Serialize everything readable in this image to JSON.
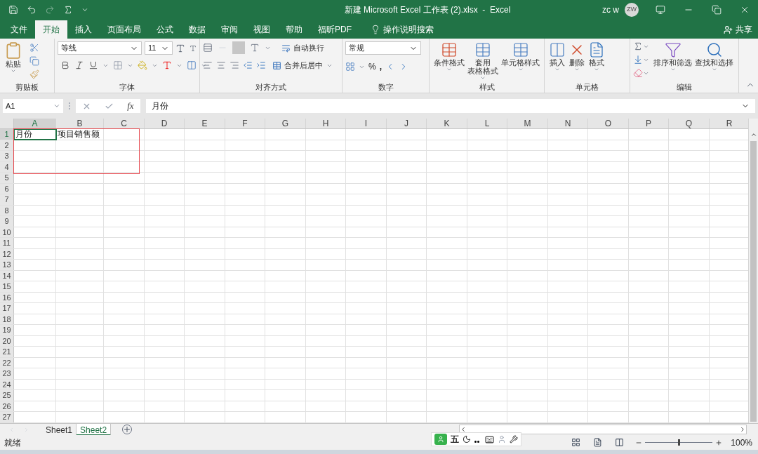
{
  "title_bar": {
    "title": "新建 Microsoft Excel 工作表 (2).xlsx  -  Excel",
    "user_name": "zc w",
    "user_initials": "ZW"
  },
  "ribbon_tabs": [
    {
      "label": "文件",
      "selected": false
    },
    {
      "label": "开始",
      "selected": true
    },
    {
      "label": "插入",
      "selected": false
    },
    {
      "label": "页面布局",
      "selected": false
    },
    {
      "label": "公式",
      "selected": false
    },
    {
      "label": "数据",
      "selected": false
    },
    {
      "label": "审阅",
      "selected": false
    },
    {
      "label": "视图",
      "selected": false
    },
    {
      "label": "帮助",
      "selected": false
    },
    {
      "label": "福昕PDF",
      "selected": false
    }
  ],
  "tell_me": "操作说明搜索",
  "share": "共享",
  "ribbon": {
    "clipboard": {
      "paste": "粘贴",
      "label": "剪贴板"
    },
    "font": {
      "font_name": "等线",
      "font_size": "11",
      "label": "字体"
    },
    "alignment": {
      "wrap": "自动换行",
      "merge": "合并后居中",
      "label": "对齐方式"
    },
    "number": {
      "format": "常规",
      "percent": "%",
      "comma": ",",
      "label": "数字"
    },
    "styles": {
      "buttons": [
        {
          "lines": [
            "条件格式"
          ]
        },
        {
          "lines": [
            "套用",
            "表格格式"
          ]
        },
        {
          "lines": [
            "单元格样式"
          ]
        }
      ],
      "label": "样式"
    },
    "cells": {
      "buttons": [
        "插入",
        "删除",
        "格式"
      ],
      "label": "单元格"
    },
    "editing": {
      "sort": "排序和筛选",
      "find": "查找和选择",
      "label": "编辑"
    }
  },
  "formula_bar": {
    "name_box": "A1",
    "fx": "fx",
    "content": "月份"
  },
  "columns": [
    "A",
    "B",
    "C",
    "D",
    "E",
    "F",
    "G",
    "H",
    "I",
    "J",
    "K",
    "L",
    "M",
    "N",
    "O",
    "P",
    "Q",
    "R"
  ],
  "rows": [
    "1",
    "2",
    "3",
    "4",
    "5",
    "6",
    "7",
    "8",
    "9",
    "10",
    "11",
    "12",
    "13",
    "14",
    "15",
    "16",
    "17",
    "18",
    "19",
    "20",
    "21",
    "22",
    "23",
    "24",
    "25",
    "26",
    "27"
  ],
  "filled_rows": [
    {
      "cells": [
        {
          "value": "月份",
          "selected": true
        },
        {
          "value": "项目销售额",
          "selected": false
        }
      ]
    }
  ],
  "sheet_tabs": [
    {
      "label": "Sheet1",
      "selected": false
    },
    {
      "label": "Sheet2",
      "selected": true
    }
  ],
  "ime": {
    "mode": "五"
  },
  "status_bar": {
    "status": "就绪",
    "zoom": "100%",
    "zoom_slider": {
      "level": 0.5
    }
  }
}
